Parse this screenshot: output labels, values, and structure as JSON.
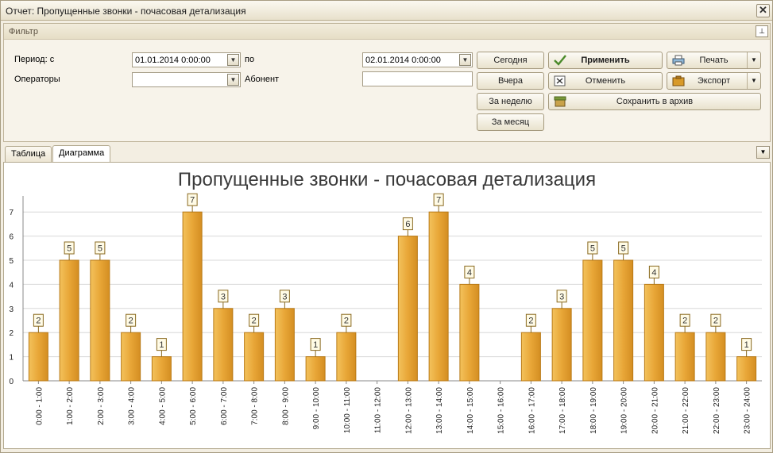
{
  "window": {
    "title": "Отчет: Пропущенные звонки - почасовая детализация",
    "close_glyph": "✕"
  },
  "filter": {
    "header": "Фильтр",
    "pin_glyph": "⊥",
    "period_label": "Период: с",
    "period_from": "01.01.2014 0:00:00",
    "to_label": "по",
    "period_to": "02.01.2014 0:00:00",
    "operators_label": "Операторы",
    "operators_value": "",
    "subscriber_label": "Абонент",
    "subscriber_value": ""
  },
  "buttons": {
    "today": "Сегодня",
    "yesterday": "Вчера",
    "week": "За неделю",
    "month": "За месяц",
    "apply": "Применить",
    "cancel": "Отменить",
    "save_archive": "Сохранить в архив",
    "print": "Печать",
    "export": "Экспорт"
  },
  "tabs": [
    {
      "label": "Таблица",
      "active": false
    },
    {
      "label": "Диаграмма",
      "active": true
    }
  ],
  "colors": {
    "bar": "#e8a637",
    "bar_dark": "#b97a16",
    "grid": "#d8d8d8"
  },
  "chart_data": {
    "type": "bar",
    "title": "Пропущенные звонки - почасовая детализация",
    "xlabel": "",
    "ylabel": "",
    "ylim": [
      0,
      7.5
    ],
    "yticks": [
      0,
      1,
      2,
      3,
      4,
      5,
      6,
      7
    ],
    "grid": true,
    "categories": [
      "0:00 - 1:00",
      "1:00 - 2:00",
      "2:00 - 3:00",
      "3:00 - 4:00",
      "4:00 - 5:00",
      "5:00 - 6:00",
      "6:00 - 7:00",
      "7:00 - 8:00",
      "8:00 - 9:00",
      "9:00 - 10:00",
      "10:00 - 11:00",
      "11:00 - 12:00",
      "12:00 - 13:00",
      "13:00 - 14:00",
      "14:00 - 15:00",
      "15:00 - 16:00",
      "16:00 - 17:00",
      "17:00 - 18:00",
      "18:00 - 19:00",
      "19:00 - 20:00",
      "20:00 - 21:00",
      "21:00 - 22:00",
      "22:00 - 23:00",
      "23:00 - 24:00"
    ],
    "values": [
      2,
      5,
      5,
      2,
      1,
      7,
      3,
      2,
      3,
      1,
      2,
      0,
      6,
      7,
      4,
      0,
      2,
      3,
      5,
      5,
      4,
      2,
      2,
      1
    ]
  }
}
